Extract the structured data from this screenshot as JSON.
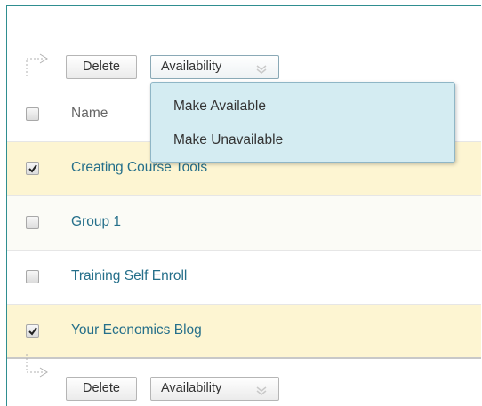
{
  "top_actions": {
    "delete_label": "Delete",
    "availability_label": "Availability"
  },
  "bottom_actions": {
    "delete_label": "Delete",
    "availability_label": "Availability"
  },
  "availability_menu": {
    "items": [
      "Make Available",
      "Make Unavailable"
    ]
  },
  "table": {
    "header": {
      "name": "Name"
    },
    "rows": [
      {
        "name": "Creating Course Tools",
        "checked": true
      },
      {
        "name": "Group 1",
        "checked": false
      },
      {
        "name": "Training Self Enroll",
        "checked": false
      },
      {
        "name": "Your Economics Blog",
        "checked": true
      }
    ]
  },
  "colors": {
    "accent_border": "#2f8e90",
    "link_text": "#256f8a",
    "selected_row": "#fdf5d2",
    "menu_bg": "#d4ecf2"
  },
  "icons": {
    "bar_arrow": "corner-arrow-icon",
    "dropdown": "chevron-down-icon",
    "checkbox_mark": "checkmark-icon"
  }
}
